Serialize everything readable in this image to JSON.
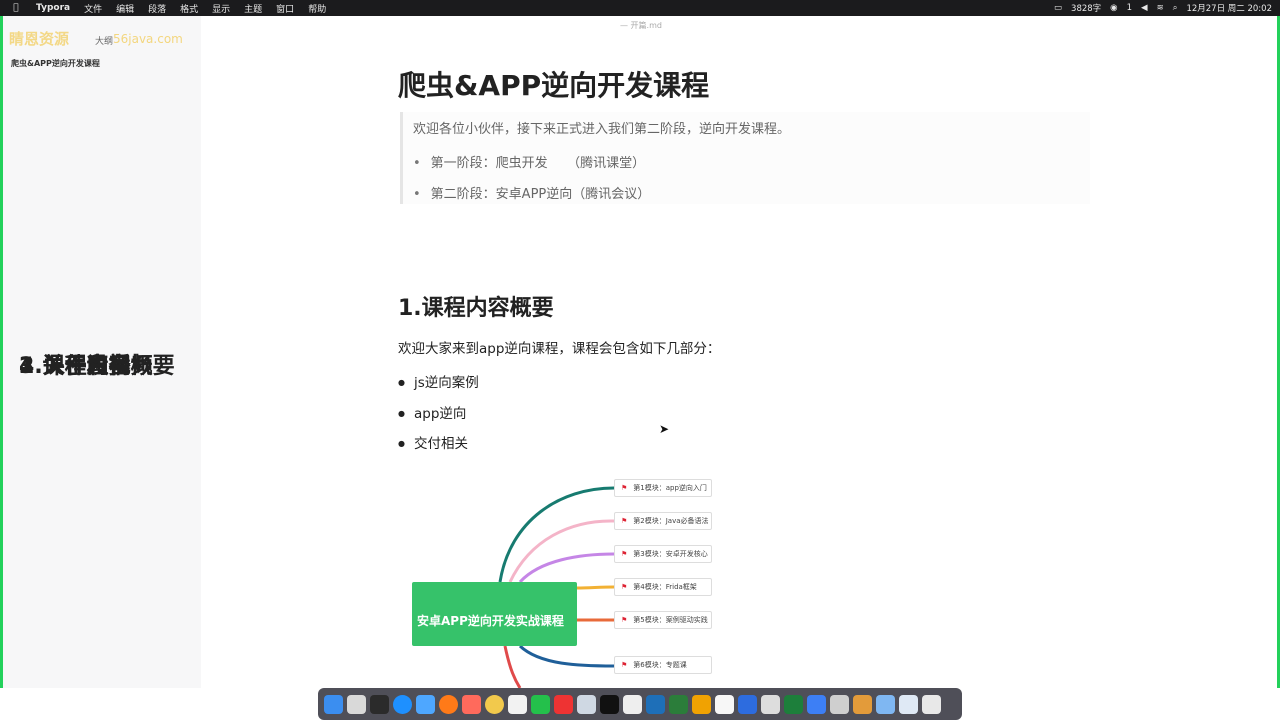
{
  "menubar": {
    "apple": "",
    "app": "Typora",
    "items": [
      "文件",
      "编辑",
      "段落",
      "格式",
      "显示",
      "主题",
      "窗口",
      "帮助"
    ],
    "status": {
      "words": "3828字",
      "wechat_count": "1",
      "datetime": "12月27日 周二 20:02"
    }
  },
  "sidebar": {
    "watermark": "睛恩资源",
    "watermark_outline": "大纲",
    "watermark_site": "56java.com",
    "toc": {
      "h1": "爬虫&APP逆向开发课程",
      "items": [
        "1.课程内容概要",
        "2.关于直播",
        "3.课件和视频",
        "4.关于设备"
      ]
    }
  },
  "doc": {
    "filename": "— 开篇.md",
    "title": "爬虫&APP逆向开发课程",
    "quote": {
      "text": "欢迎各位小伙伴，接下来正式进入我们第二阶段，逆向开发课程。",
      "items": [
        "第一阶段：爬虫开发　　（腾讯课堂）",
        "第二阶段：安卓APP逆向（腾讯会议）"
      ]
    },
    "section1": {
      "title": "1.课程内容概要",
      "intro": "欢迎大家来到app逆向课程，课程会包含如下几部分：",
      "items": [
        "js逆向案例",
        "app逆向",
        "交付相关"
      ]
    },
    "mindmap": {
      "root": "安卓APP逆向开发实战课程",
      "nodes": [
        "第1模块：app逆向入门",
        "第2模块：Java必备语法",
        "第3模块：安卓开发核心",
        "第4模块：Frida框架",
        "第5模块：案例驱动实践",
        "第6模块：专题课"
      ]
    }
  },
  "colors": {
    "accent_green": "#36c26a",
    "edge_green": "#23d15b"
  }
}
